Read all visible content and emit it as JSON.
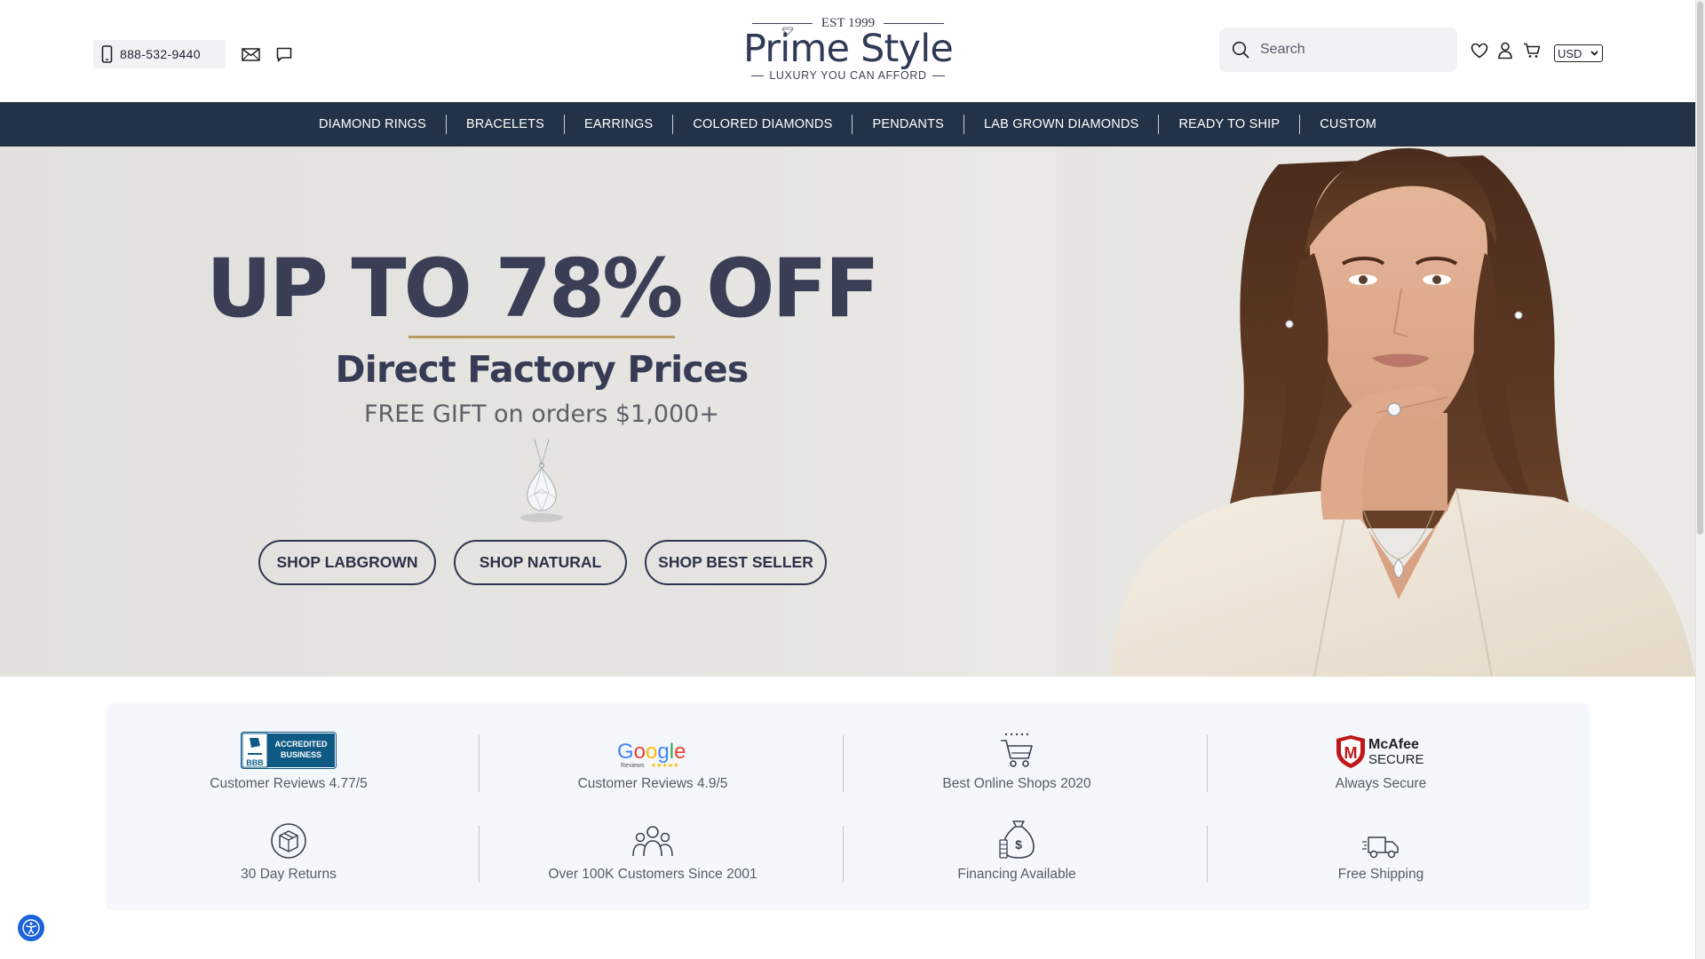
{
  "header": {
    "phone": "888-532-9440",
    "logo": {
      "est": "EST 1999",
      "name": "Prime Style",
      "tagline": "LUXURY YOU CAN AFFORD"
    },
    "search_placeholder": "Search",
    "currency": "USD",
    "icons": [
      "phone-icon",
      "mail-icon",
      "chat-icon",
      "search-icon",
      "heart-icon",
      "user-icon",
      "cart-icon"
    ]
  },
  "nav": {
    "items": [
      "DIAMOND RINGS",
      "BRACELETS",
      "EARRINGS",
      "COLORED DIAMONDS",
      "PENDANTS",
      "LAB GROWN DIAMONDS",
      "READY TO SHIP",
      "CUSTOM"
    ]
  },
  "hero": {
    "title": "UP TO 78% OFF",
    "subtitle": "Direct Factory Prices",
    "gift": "FREE GIFT on orders $1,000+",
    "buttons": [
      "SHOP LABGROWN",
      "SHOP NATURAL",
      "SHOP BEST SELLER"
    ],
    "accent_color": "#b89b5e",
    "text_color": "#3a3f56"
  },
  "trust": {
    "row1": [
      {
        "icon": "bbb-accredited-icon",
        "badge_text": "ACCREDITED BUSINESS",
        "label": "Customer Reviews 4.77/5"
      },
      {
        "icon": "google-reviews-icon",
        "badge_text": "Google",
        "label": "Customer Reviews 4.9/5"
      },
      {
        "icon": "shopping-cart-icon",
        "label": "Best Online Shops 2020"
      },
      {
        "icon": "mcafee-secure-icon",
        "badge_text": "McAfee SECURE",
        "label": "Always Secure"
      }
    ],
    "row2": [
      {
        "icon": "box-return-icon",
        "label": "30 Day Returns"
      },
      {
        "icon": "customers-group-icon",
        "label": "Over 100K Customers Since 2001"
      },
      {
        "icon": "money-bag-icon",
        "label": "Financing Available"
      },
      {
        "icon": "delivery-truck-icon",
        "label": "Free Shipping"
      }
    ]
  },
  "colors": {
    "nav_bg": "#233347",
    "brand": "#2f3a56",
    "trust_bg": "#f4f7fb",
    "a11y": "#1e62d9"
  }
}
